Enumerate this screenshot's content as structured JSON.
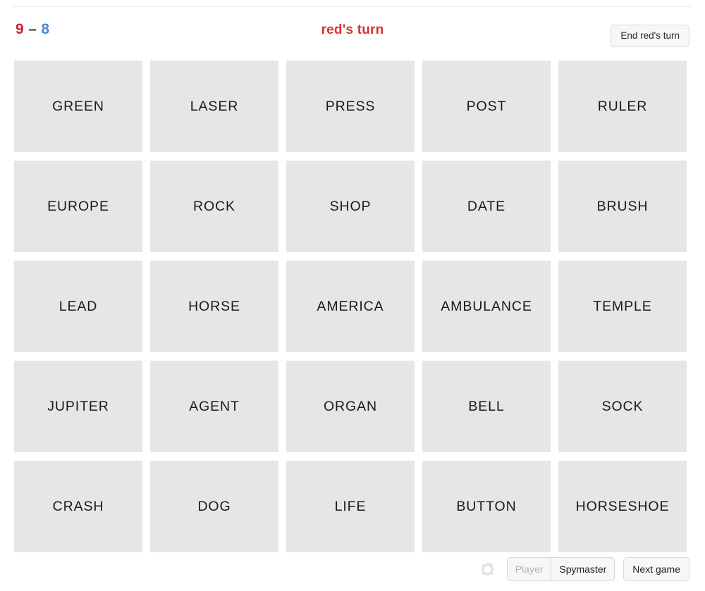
{
  "header": {
    "score": {
      "red": "9",
      "separator": "–",
      "blue": "8",
      "red_color": "#d0232b",
      "blue_color": "#4a86d6"
    },
    "turn_text": "red's turn",
    "turn_color": "#e03030",
    "end_turn_label": "End red's turn"
  },
  "board": {
    "rows": 5,
    "columns": 5,
    "card_color": "#e6e6e6",
    "cards": [
      {
        "word": "GREEN"
      },
      {
        "word": "LASER"
      },
      {
        "word": "PRESS"
      },
      {
        "word": "POST"
      },
      {
        "word": "RULER"
      },
      {
        "word": "EUROPE"
      },
      {
        "word": "ROCK"
      },
      {
        "word": "SHOP"
      },
      {
        "word": "DATE"
      },
      {
        "word": "BRUSH"
      },
      {
        "word": "LEAD"
      },
      {
        "word": "HORSE"
      },
      {
        "word": "AMERICA"
      },
      {
        "word": "AMBULANCE"
      },
      {
        "word": "TEMPLE"
      },
      {
        "word": "JUPITER"
      },
      {
        "word": "AGENT"
      },
      {
        "word": "ORGAN"
      },
      {
        "word": "BELL"
      },
      {
        "word": "SOCK"
      },
      {
        "word": "CRASH"
      },
      {
        "word": "DOG"
      },
      {
        "word": "LIFE"
      },
      {
        "word": "BUTTON"
      },
      {
        "word": "HORSESHOE"
      }
    ]
  },
  "toolbar": {
    "settings_icon": "gear-icon",
    "view_modes": [
      {
        "label": "Player",
        "selected": false
      },
      {
        "label": "Spymaster",
        "selected": true
      }
    ],
    "next_game_label": "Next game"
  }
}
